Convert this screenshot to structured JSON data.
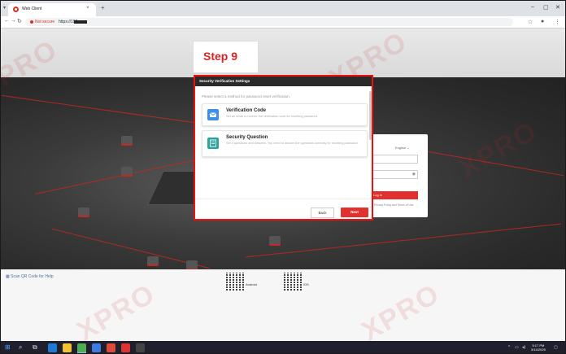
{
  "browser": {
    "tab_title": "Web Client",
    "tab_close": "×",
    "new_tab": "+",
    "not_secure": "Not secure",
    "url": "https://192.",
    "window_controls": [
      "–",
      "▢",
      "✕"
    ]
  },
  "page": {
    "watermark": "XPRO",
    "qr_help": "Scan QR Code for Help",
    "qr_labels": [
      "Android",
      "iOS"
    ],
    "login": {
      "language": "English",
      "login_button": "Log In",
      "footer": "Privacy Policy and Terms of Use"
    }
  },
  "step_label": "Step 9",
  "dialog": {
    "title": "Security Verification Settings",
    "subtitle": "Please select a method for password reset verification.",
    "options": [
      {
        "title": "Verification Code",
        "description": "Set an email to receive the verification code for resetting password.",
        "icon": "email-icon",
        "color": "#3b8fe8"
      },
      {
        "title": "Security Question",
        "description": "Set 3 questions and answers. You need to answer the questions correctly for resetting password.",
        "icon": "question-card-icon",
        "color": "#26a69a"
      }
    ],
    "back_label": "Back",
    "next_label": "Next"
  },
  "taskbar": {
    "time": "5:17 PM",
    "date": "3/14/2025"
  },
  "colors": {
    "accent": "#e0312f",
    "highlight_border": "#ee1111"
  }
}
